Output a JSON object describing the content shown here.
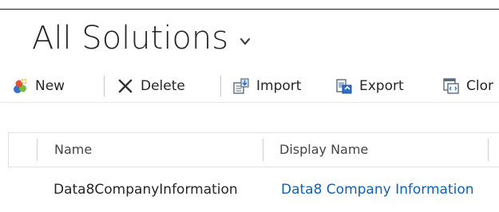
{
  "page": {
    "title": "All Solutions"
  },
  "toolbar": {
    "new_label": "New",
    "delete_label": "Delete",
    "import_label": "Import",
    "export_label": "Export",
    "clone_label": "Clor"
  },
  "grid": {
    "columns": [
      "Name",
      "Display Name"
    ],
    "rows": [
      {
        "name": "Data8CompanyInformation",
        "display_name": "Data8 Company Information"
      }
    ]
  },
  "icons": {
    "title_chevron": "chevron-down-icon",
    "new": "new-solution-icon",
    "delete": "close-icon",
    "import": "import-icon",
    "export": "export-icon",
    "clone": "clone-icon"
  },
  "colors": {
    "link": "#1160b7",
    "text": "#262626",
    "border": "#e1e1e1"
  }
}
